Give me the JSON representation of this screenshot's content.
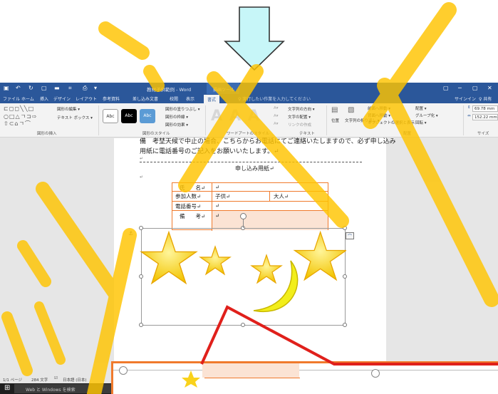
{
  "window": {
    "title": "教材子供範例 - Word",
    "context_tab_group": "描画ツール",
    "quick_access": [
      "↶",
      "↻",
      "▢",
      "▬",
      "⌗",
      "⎙",
      "▾"
    ],
    "window_controls": [
      "▢",
      "─",
      "▢",
      "✕"
    ]
  },
  "tabs": {
    "items": [
      "ファイル",
      "ホーム",
      "挿入",
      "デザイン",
      "レイアウト",
      "参考資料",
      "差し込み文書",
      "校閲",
      "表示"
    ],
    "active": "書式",
    "tell_me": "♀ 実行したい作業を入力してください",
    "signin": "サインイン",
    "share": "♀ 共有"
  },
  "ribbon": {
    "insert_shapes": {
      "label": "図形の挿入",
      "edit_shape": "図形の編集 ▾",
      "textbox": "テキスト ボックス ▾"
    },
    "shape_styles": {
      "label": "図形のスタイル",
      "fill": "図形の塗りつぶし ▾",
      "outline": "図形の枠線 ▾",
      "effects": "図形の効果 ▾",
      "samples": [
        "Abc",
        "Abc",
        "Abc"
      ]
    },
    "wordart_styles": {
      "label": "ワードアートのスタイル",
      "samples": [
        "A",
        "A",
        "A"
      ]
    },
    "text": {
      "label": "テキスト",
      "direction": "文字列の方向 ▾",
      "align": "文字の配置 ▾",
      "link": "リンクの作成"
    },
    "arrange": {
      "label": "配置",
      "position": "位置",
      "wrap": "文字列の折り返し ▾",
      "bring_forward": "前面へ移動 ▾",
      "send_backward": "背面へ移動 ▾",
      "selection_pane": "オブジェクトの選択と表示",
      "align": "配置 ▾",
      "group": "グループ化 ▾",
      "rotate": "回転 ▾"
    },
    "size": {
      "label": "サイズ",
      "height": "69.78 mm",
      "width": "152.22 mm"
    }
  },
  "document": {
    "line1": "備　考埜天候で中止の場合、こちらからお電話にてご連絡いたしますので、必ず申し込み",
    "line2": "用紙に電話番号のご記入をお願いいたします。↵",
    "form_heading": "申し込み用紙↵",
    "table": {
      "rows": [
        {
          "label": "氏　　名↵",
          "cells": [
            "↵"
          ]
        },
        {
          "label": "参加人数↵",
          "cells": [
            "子供↵",
            "大人↵"
          ]
        },
        {
          "label": "電話番号↵",
          "cells": [
            "↵"
          ]
        },
        {
          "label": "備　　考↵",
          "cells": [
            "↵"
          ]
        }
      ]
    }
  },
  "status": {
    "page": "1/1 ページ",
    "words": "284 文字",
    "lang": "日本語 (日本)"
  },
  "taskbar": {
    "start": "⊞",
    "search_placeholder": "Web と Windows を検索"
  },
  "colors": {
    "word_blue": "#2b579a",
    "highlight_orange": "#f07a2c",
    "callout_red": "#e0201b",
    "star_yellow": "#f9d21c",
    "moon_yellow": "#f2ee1a",
    "arrow_fill": "#c7f6f8",
    "watermark_yellow": "#ffc400"
  },
  "icons": [
    "down-arrow-icon",
    "star-icon",
    "moon-icon",
    "anchor-icon",
    "layout-options-icon",
    "windows-logo-icon"
  ]
}
